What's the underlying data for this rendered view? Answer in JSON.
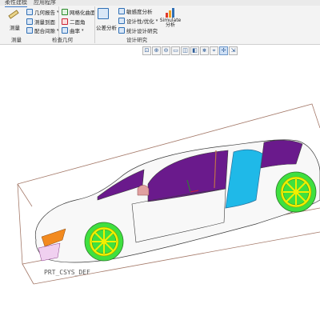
{
  "ribbon": {
    "tabs": [
      {
        "label": "柔性建模",
        "active": true
      },
      {
        "label": "应用程序",
        "active": false
      }
    ],
    "groups": {
      "measure": {
        "measure_label": "测量",
        "items": [
          "几何报告",
          "测量到面",
          "配合间隙"
        ]
      },
      "geometry_check": {
        "items": [
          "网格化曲面",
          "二面角",
          "曲率"
        ],
        "group_label": "检查几何"
      },
      "design_study": {
        "tolerance_label": "公差分析",
        "items": [
          "敏感度分析",
          "设计性/优化",
          "统计设计研究"
        ],
        "simulate_label": "Simulate 分析",
        "group_label": "设计研究"
      }
    }
  },
  "view_toolbar": {
    "buttons": [
      "zoom-fit",
      "zoom-in",
      "zoom-out",
      "repaint",
      "saved-views",
      "display-style",
      "datum-display",
      "spin-center",
      "annotation-display",
      "named-views"
    ],
    "active": [
      "spin-center"
    ]
  },
  "model": {
    "csys_label": "PRT_CSYS_DEF",
    "colors": {
      "body": "#f8f8f8",
      "edge": "#3a3a3a",
      "glass": "#6a1a8c",
      "door": "#1fb9e8",
      "wheel": "#3fe03f",
      "rim": "#f0f000",
      "headlight": "#f28a1f",
      "bounding": "#a57a6a",
      "side_blade": "#c0704a",
      "mirror": "#e0a0a0"
    }
  }
}
